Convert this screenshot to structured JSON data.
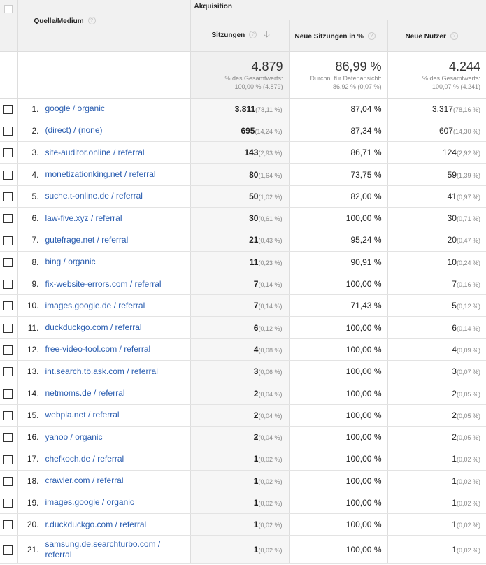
{
  "header": {
    "group_label": "Akquisition",
    "dimension_label": "Quelle/Medium",
    "col_sessions": "Sitzungen",
    "col_new_session_pct": "Neue Sitzungen in %",
    "col_new_users": "Neue Nutzer",
    "sort_icon": "sort-down-arrow-icon",
    "help_icon": "question-mark-icon"
  },
  "totals": {
    "sessions": "4.879",
    "sessions_sub1": "% des Gesamtwerts:",
    "sessions_sub2": "100,00 % (4.879)",
    "new_pct": "86,99 %",
    "new_pct_sub1": "Durchn. für Datenansicht:",
    "new_pct_sub2": "86,92 % (0,07 %)",
    "new_users": "4.244",
    "new_users_sub1": "% des Gesamtwerts:",
    "new_users_sub2": "100,07 % (4.241)"
  },
  "rows": [
    {
      "n": "1.",
      "src": "google / organic",
      "s": "3.811",
      "sp": "(78,11 %)",
      "np": "87,04 %",
      "u": "3.317",
      "up": "(78,16 %)"
    },
    {
      "n": "2.",
      "src": "(direct) / (none)",
      "s": "695",
      "sp": "(14,24 %)",
      "np": "87,34 %",
      "u": "607",
      "up": "(14,30 %)"
    },
    {
      "n": "3.",
      "src": "site-auditor.online / referral",
      "s": "143",
      "sp": "(2,93 %)",
      "np": "86,71 %",
      "u": "124",
      "up": "(2,92 %)"
    },
    {
      "n": "4.",
      "src": "monetizationking.net / referral",
      "s": "80",
      "sp": "(1,64 %)",
      "np": "73,75 %",
      "u": "59",
      "up": "(1,39 %)"
    },
    {
      "n": "5.",
      "src": "suche.t-online.de / referral",
      "s": "50",
      "sp": "(1,02 %)",
      "np": "82,00 %",
      "u": "41",
      "up": "(0,97 %)"
    },
    {
      "n": "6.",
      "src": "law-five.xyz / referral",
      "s": "30",
      "sp": "(0,61 %)",
      "np": "100,00 %",
      "u": "30",
      "up": "(0,71 %)"
    },
    {
      "n": "7.",
      "src": "gutefrage.net / referral",
      "s": "21",
      "sp": "(0,43 %)",
      "np": "95,24 %",
      "u": "20",
      "up": "(0,47 %)"
    },
    {
      "n": "8.",
      "src": "bing / organic",
      "s": "11",
      "sp": "(0,23 %)",
      "np": "90,91 %",
      "u": "10",
      "up": "(0,24 %)"
    },
    {
      "n": "9.",
      "src": "fix-website-errors.com / referral",
      "s": "7",
      "sp": "(0,14 %)",
      "np": "100,00 %",
      "u": "7",
      "up": "(0,16 %)"
    },
    {
      "n": "10.",
      "src": "images.google.de / referral",
      "s": "7",
      "sp": "(0,14 %)",
      "np": "71,43 %",
      "u": "5",
      "up": "(0,12 %)"
    },
    {
      "n": "11.",
      "src": "duckduckgo.com / referral",
      "s": "6",
      "sp": "(0,12 %)",
      "np": "100,00 %",
      "u": "6",
      "up": "(0,14 %)"
    },
    {
      "n": "12.",
      "src": "free-video-tool.com / referral",
      "s": "4",
      "sp": "(0,08 %)",
      "np": "100,00 %",
      "u": "4",
      "up": "(0,09 %)"
    },
    {
      "n": "13.",
      "src": "int.search.tb.ask.com / referral",
      "s": "3",
      "sp": "(0,06 %)",
      "np": "100,00 %",
      "u": "3",
      "up": "(0,07 %)"
    },
    {
      "n": "14.",
      "src": "netmoms.de / referral",
      "s": "2",
      "sp": "(0,04 %)",
      "np": "100,00 %",
      "u": "2",
      "up": "(0,05 %)"
    },
    {
      "n": "15.",
      "src": "webpla.net / referral",
      "s": "2",
      "sp": "(0,04 %)",
      "np": "100,00 %",
      "u": "2",
      "up": "(0,05 %)"
    },
    {
      "n": "16.",
      "src": "yahoo / organic",
      "s": "2",
      "sp": "(0,04 %)",
      "np": "100,00 %",
      "u": "2",
      "up": "(0,05 %)"
    },
    {
      "n": "17.",
      "src": "chefkoch.de / referral",
      "s": "1",
      "sp": "(0,02 %)",
      "np": "100,00 %",
      "u": "1",
      "up": "(0,02 %)"
    },
    {
      "n": "18.",
      "src": "crawler.com / referral",
      "s": "1",
      "sp": "(0,02 %)",
      "np": "100,00 %",
      "u": "1",
      "up": "(0,02 %)"
    },
    {
      "n": "19.",
      "src": "images.google / organic",
      "s": "1",
      "sp": "(0,02 %)",
      "np": "100,00 %",
      "u": "1",
      "up": "(0,02 %)"
    },
    {
      "n": "20.",
      "src": "r.duckduckgo.com / referral",
      "s": "1",
      "sp": "(0,02 %)",
      "np": "100,00 %",
      "u": "1",
      "up": "(0,02 %)"
    },
    {
      "n": "21.",
      "src": "samsung.de.searchturbo.com / referral",
      "s": "1",
      "sp": "(0,02 %)",
      "np": "100,00 %",
      "u": "1",
      "up": "(0,02 %)"
    }
  ]
}
